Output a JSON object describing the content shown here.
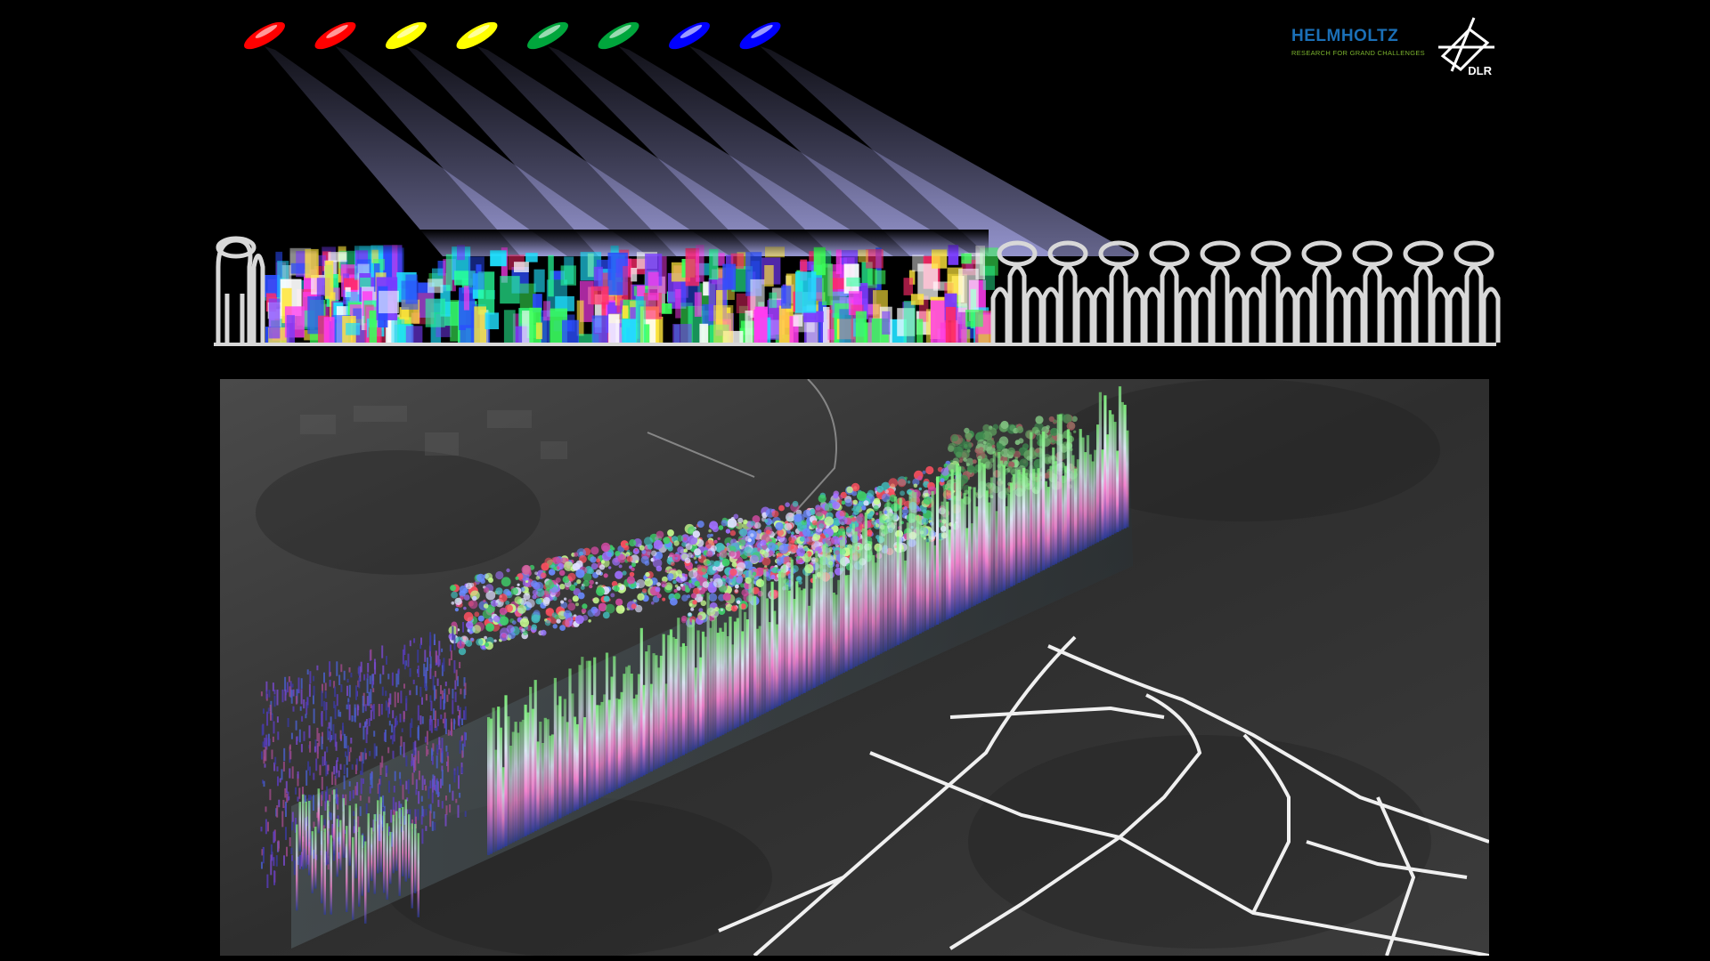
{
  "logos": {
    "helmholtz": {
      "name": "HELMHOLTZ",
      "tagline": "RESEARCH FOR GRAND CHALLENGES",
      "color": "#1b6fb6",
      "tagline_color": "#7bb32e"
    },
    "dlr": {
      "name": "DLR",
      "color": "#ffffff"
    }
  },
  "sensors": {
    "colors": [
      "#ff0000",
      "#ff0000",
      "#ffff00",
      "#ffff00",
      "#00a63c",
      "#00a63c",
      "#0000ff",
      "#0000ff"
    ]
  },
  "illustration": {
    "beam_color": "#b8b8ff",
    "tree_outline_color": "#d8d8d8",
    "background_color": "#000000"
  },
  "scene": {
    "description_icon": "3d-forest-tomography-scene",
    "map_tint": "#3a3a3a",
    "road_color": "#f0f0f0"
  }
}
